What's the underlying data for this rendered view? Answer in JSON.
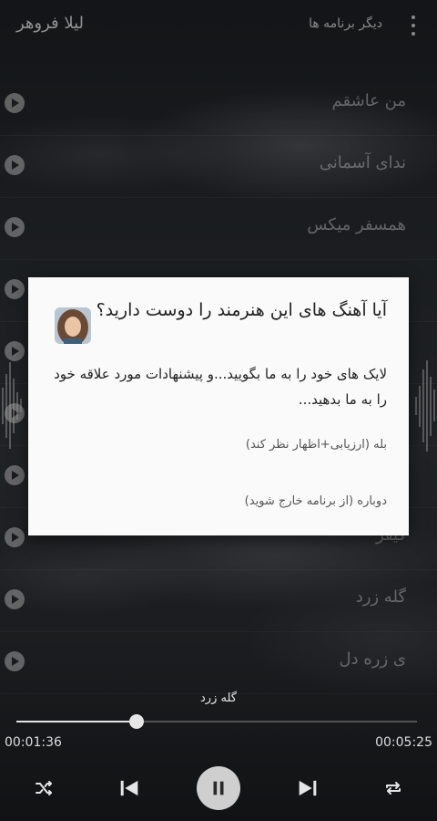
{
  "header": {
    "app_title": "لیلا فروهر",
    "more_apps_label": "دیگر برنامه ها",
    "menu_icon": "more-vert-icon"
  },
  "songs": [
    {
      "title": "من عاشقم"
    },
    {
      "title": "ندای آسمانی"
    },
    {
      "title": "همسفر میکس"
    },
    {
      "title": ""
    },
    {
      "title": ""
    },
    {
      "title": ""
    },
    {
      "title": ""
    },
    {
      "title": "گیفر"
    },
    {
      "title": "گله زرد"
    },
    {
      "title": "ی زره دل"
    }
  ],
  "dialog": {
    "title": "آیا آهنگ های این هنرمند را دوست دارید؟",
    "body": "لایک های خود را به ما بگویید...و پیشنهادات مورد علاقه خود را به ما بدهید...",
    "yes_option": "بله (ارزیابی+اظهار نظر کند)",
    "later_option": "دوباره (از برنامه خارج شوید)"
  },
  "player": {
    "current_song": "گله زرد",
    "elapsed": "00:01:36",
    "total": "00:05:25",
    "progress_fraction": 0.3
  },
  "controls": {
    "shuffle_icon": "shuffle-icon",
    "previous_icon": "skip-previous-icon",
    "pause_icon": "pause-icon",
    "next_icon": "skip-next-icon",
    "repeat_icon": "repeat-icon"
  },
  "colors": {
    "background": "#2a2d31",
    "dialog_background": "#fafafa"
  }
}
